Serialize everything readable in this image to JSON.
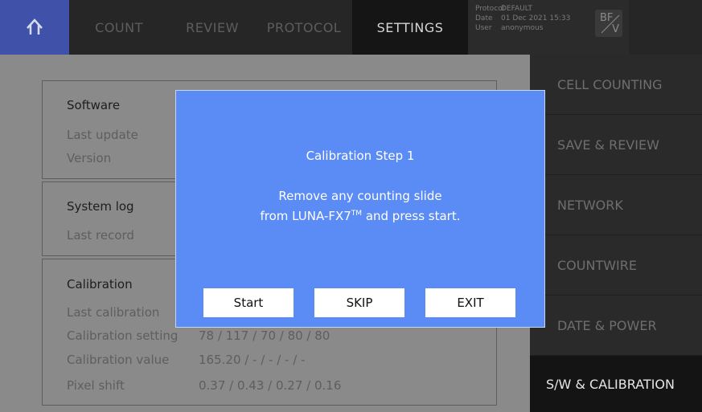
{
  "topbar": {
    "tabs": {
      "count": "COUNT",
      "review": "REVIEW",
      "protocol": "PROTOCOL",
      "settings": "SETTINGS"
    },
    "meta": {
      "protocol_label": "Protocol",
      "protocol_value": "DEFAULT",
      "date_label": "Date",
      "date_value": "01 Dec 2021 15:33",
      "user_label": "User",
      "user_value": "anonymous"
    },
    "mode_badge": {
      "top": "BF",
      "bottom": "V"
    }
  },
  "sidebar": {
    "items": [
      {
        "label": "CELL COUNTING"
      },
      {
        "label": "SAVE & REVIEW"
      },
      {
        "label": "NETWORK"
      },
      {
        "label": "COUNTWIRE"
      },
      {
        "label": "DATE & POWER"
      },
      {
        "label": "S/W & CALIBRATION"
      }
    ]
  },
  "software": {
    "title": "Software",
    "last_update_label": "Last update",
    "version_label": "Version"
  },
  "system_log": {
    "title": "System log",
    "last_record_label": "Last record"
  },
  "calibration": {
    "title": "Calibration",
    "last_calibration_label": "Last calibration",
    "setting_label": "Calibration setting",
    "setting_value": "78 / 117 / 70 / 80 / 80",
    "value_label": "Calibration value",
    "value_value": "165.20 / - / - / - / -",
    "pixel_shift_label": "Pixel shift",
    "pixel_shift_value": "0.37 / 0.43 / 0.27 / 0.16"
  },
  "modal": {
    "title": "Calibration Step 1",
    "message_line1": "Remove any counting slide",
    "message_line2_prefix": "from LUNA-FX7",
    "message_tm": "TM",
    "message_line2_suffix": " and press start.",
    "buttons": {
      "start": "Start",
      "skip": "SKIP",
      "exit": "EXIT"
    }
  }
}
